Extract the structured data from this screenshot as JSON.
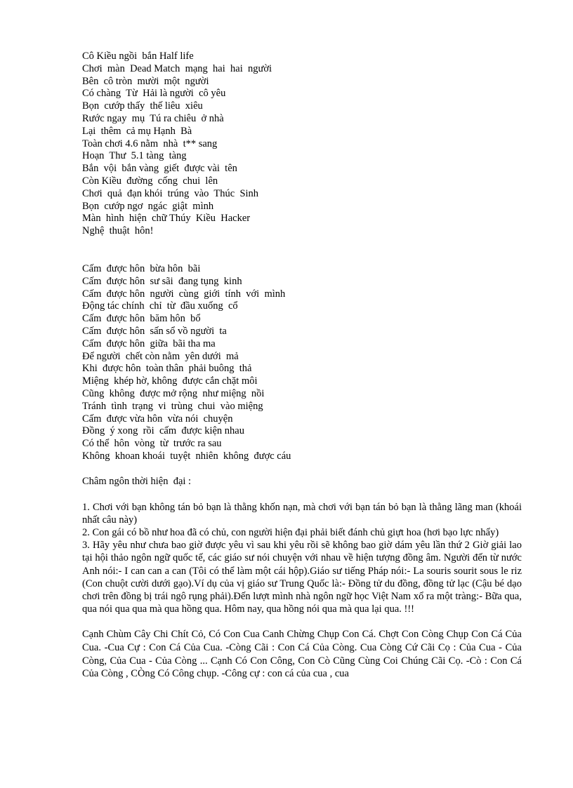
{
  "document": {
    "background_color": "#ffffff",
    "text_color": "#000000",
    "language": "vi"
  },
  "poem_half_life": {
    "title_line": "Cô Kiều ngồi bắn Half life",
    "verses": [
      "Cô Kiều ngồi  bắn Half life",
      "Chơi  màn  Dead Match  mạng  hai  hai  người",
      "Bên  cô tròn  mười  một  người",
      "Có chàng  Từ  Hải là người  cô yêu",
      "Bọn  cướp thấy  thế liêu  xiêu",
      "Rước ngay  mụ  Tú ra chiêu  ở nhà",
      "Lại  thêm  cả mụ Hạnh  Bà",
      "Toàn chơi 4.6 nằm  nhà  t** sang",
      "Hoạn  Thư  5.1 tàng  tàng",
      "Bắn  vội  bắn vàng  giết  được vài  tên",
      "Còn Kiều  đường  cống  chui  lên",
      "Chơi  quả  đạn khói  trúng  vào  Thúc  Sinh",
      "Bọn  cướp ngơ  ngác  giật  mình",
      "Màn  hình  hiện  chữ Thúy  Kiều  Hacker",
      "Nghệ  thuật  hôn!"
    ]
  },
  "poem_kissing_rules": {
    "verses": [
      "Cấm  được hôn  bừa hôn  bãi",
      "Cấm  được hôn  sư sãi  đang tụng  kinh",
      "Cấm  được hôn  người  cùng  giới  tính  với  mình",
      "Động tác chính  chỉ  từ  đầu xuống  cổ",
      "Cấm  được hôn  băm hôn  bổ",
      "Cấm  được hôn  sấn sổ vồ người  ta",
      "Cấm  được hôn  giữa  bãi tha ma",
      "Để người  chết còn nằm  yên dưới  mả",
      "Khi  được hôn  toàn thân  phải buông  thả",
      "Miệng  khép hờ, không  được cắn chặt môi",
      "Cũng  không  được mở rộng  như miệng  nồi",
      "Tránh  tình  trạng  vi  trùng  chui  vào miệng",
      "Cấm  được vừa hôn  vừa nói  chuyện",
      "Đồng  ý xong  rồi  cấm  được kiện nhau",
      "Có thể  hôn  vòng  từ  trước ra sau",
      "Không  khoan khoái  tuyệt  nhiên  không  được cáu"
    ]
  },
  "maxims_section": {
    "heading": "Châm ngôn thời hiện  đại :",
    "items": [
      "1. Chơi  với  bạn không  tán bỏ bạn là thằng  khốn nạn, mà chơi  với  bạn tán bỏ bạn là thằng  lãng man (khoái nhất câu này)",
      "2. Con gái  có bồ như hoa đã có chủ, con người  hiện  đại phải biết  đánh chủ giựt  hoa (hơi  bạo lực nhẩy)",
      "3. Hãy yêu như chưa bao giờ  được yêu vì sau khi  yêu rồi  sẽ không  bao giờ  dám yêu lần thứ 2 Giờ  giải lao tại hội  thảo ngôn ngữ  quốc tế, các giáo  sư nói  chuyện  với  nhau  về hiện  tượng  đồng  âm. Người  đến từ  nước Anh nói:-  I can can a can (Tôi  có thể  làm  một  cái hộp).Giáo  sư tiếng  Pháp nói:-  La souris  sourit sous le riz (Con chuột  cười dưới  gạo).Ví dụ của vị  giáo  sư Trung  Quốc là:- Đồng  tử  du đồng, đồng  tử lạc (Cậu bé dạo chơi  trên đồng  bị trái ngô rụng  phải).Đến lượt mình  nhà ngôn ngữ  học Việt  Nam xổ ra một tràng:-  Bữa qua, qua nói  qua qua mà qua hồng qua.  Hôm nay,  qua hồng  nói  qua mà qua lại  qua. !!!"
    ]
  },
  "tongue_twister_section": {
    "text": "Cạnh Chùm  Cây Chi Chít  Cỏ, Có Con Cua Canh Chừng  Chụp  Con Cá. Chợt Con Còng Chụp  Con Cá Của Cua. -Cua Cự : Con Cá Của Cua. -Còng Cãi : Con Cá Của Còng. Cua Còng Cứ Cãi Cọ : Của Cua - Của Còng, Của Cua - Của Còng ... Cạnh Có Con Công, Con Cò Cũng Cùng Coi Chúng  Cãi Cọ. -Cò : Con Cá Của Còng , CÒng Có Công chụp.  -Công cự : con cá của cua , cua"
  }
}
